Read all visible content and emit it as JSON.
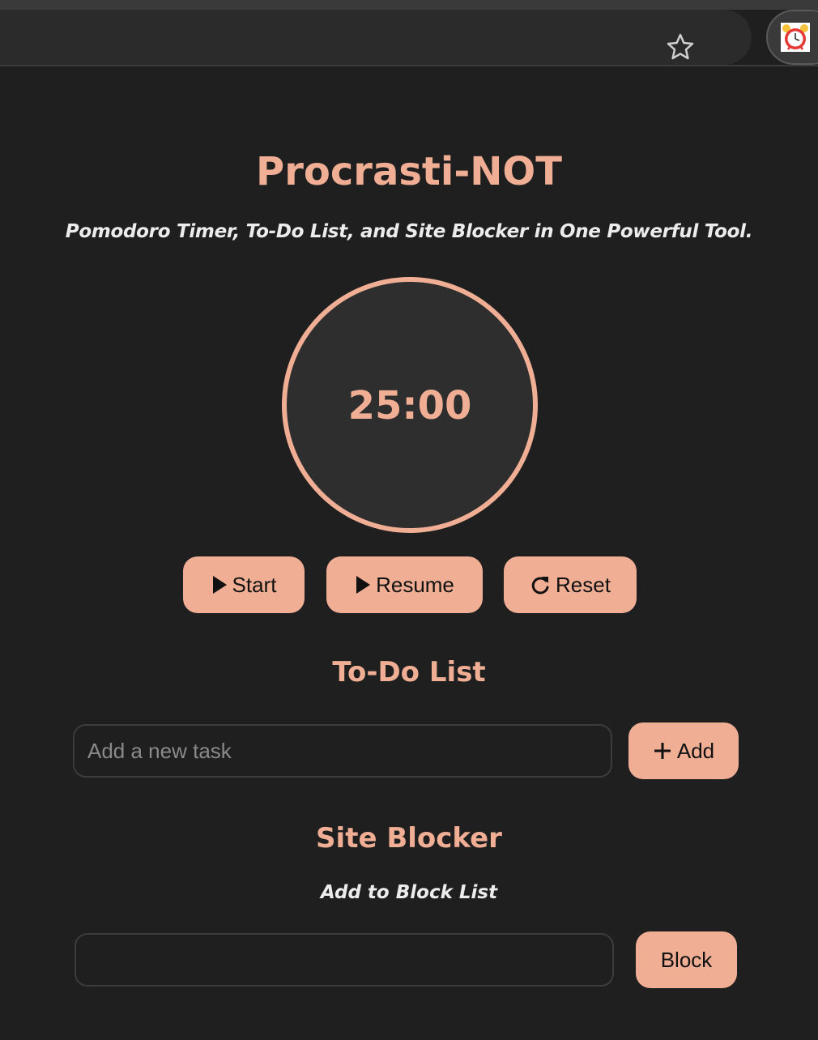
{
  "app": {
    "title": "Procrasti-NOT",
    "subtitle": "Pomodoro Timer, To-Do List, and Site Blocker in One Powerful Tool."
  },
  "browser": {
    "bookmark_icon": "star-icon",
    "extension_icon": "alarm-clock-icon"
  },
  "timer": {
    "display": "25:00",
    "buttons": {
      "start": "Start",
      "resume": "Resume",
      "reset": "Reset"
    }
  },
  "todo": {
    "heading": "To-Do List",
    "input_placeholder": "Add a new task",
    "input_value": "",
    "add_label": "Add"
  },
  "blocker": {
    "heading": "Site Blocker",
    "subheading": "Add to Block List",
    "input_value": "",
    "block_label": "Block"
  },
  "colors": {
    "accent": "#f0ae94",
    "background": "#1f1f1f",
    "timer_fill": "#2e2e2e"
  }
}
